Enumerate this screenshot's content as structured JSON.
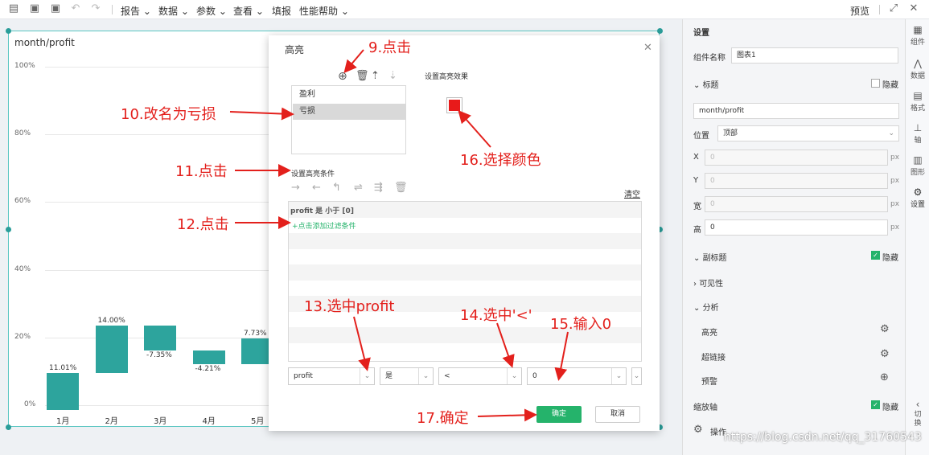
{
  "toolbar": {
    "menus": [
      "报告",
      "数据",
      "参数",
      "查看",
      "填报",
      "性能帮助"
    ],
    "preview": "预览"
  },
  "chart": {
    "title": "month/profit"
  },
  "chart_data": {
    "type": "bar",
    "title": "month/profit",
    "categories": [
      "1月",
      "2月",
      "3月",
      "4月",
      "5月"
    ],
    "values": [
      11.01,
      14.0,
      -7.35,
      -4.21,
      7.73
    ],
    "data_labels": [
      "11.01%",
      "14.00%",
      "-7.35%",
      "-4.21%",
      "7.73%"
    ],
    "yticks": [
      "100%",
      "80%",
      "60%",
      "40%",
      "20%",
      "0%"
    ],
    "ylim": [
      0,
      100
    ],
    "color": "#2da49d"
  },
  "dialog": {
    "title": "高亮",
    "rules": [
      "盈利",
      "亏损"
    ],
    "effect_label": "设置高亮效果",
    "effect_color": "#e81a1a",
    "condition_label": "设置高亮条件",
    "clear_label": "清空",
    "condition_text": "profit 是 小于 [0]",
    "add_filter_label": "+点击添加过滤条件",
    "field_value": "profit",
    "is_value": "是",
    "op_value": "<",
    "input_value": "0",
    "ok_label": "确定",
    "cancel_label": "取消"
  },
  "annotations": {
    "a9": "9.点击",
    "a10": "10.改名为亏损",
    "a11": "11.点击",
    "a12": "12.点击",
    "a13": "13.选中profit",
    "a14": "14.选中'<'",
    "a15": "15.输入0",
    "a16": "16.选择颜色",
    "a17": "17.确定"
  },
  "settings": {
    "header": "设置",
    "component_name_label": "组件名称",
    "component_name_value": "图表1",
    "title_section": "标题",
    "hide_label": "隐藏",
    "title_value": "month/profit",
    "position_label": "位置",
    "position_value": "顶部",
    "x_label": "X",
    "y_label": "Y",
    "x_value": "0",
    "y_value": "0",
    "width_label": "宽",
    "width_value": "0",
    "height_label": "高",
    "height_value": "0",
    "px": "px",
    "subtitle_section": "副标题",
    "visibility_section": "可见性",
    "analysis_section": "分析",
    "highlight_label": "高亮",
    "hyperlink_label": "超链接",
    "alert_label": "预警",
    "zoom_axis_label": "缩放轴",
    "operation_label": "操作"
  },
  "side_tabs": [
    "组件",
    "数据",
    "格式",
    "轴",
    "图形",
    "设置"
  ],
  "side_toggle": "切换",
  "watermark": "https://blog.csdn.net/qq_31760543"
}
